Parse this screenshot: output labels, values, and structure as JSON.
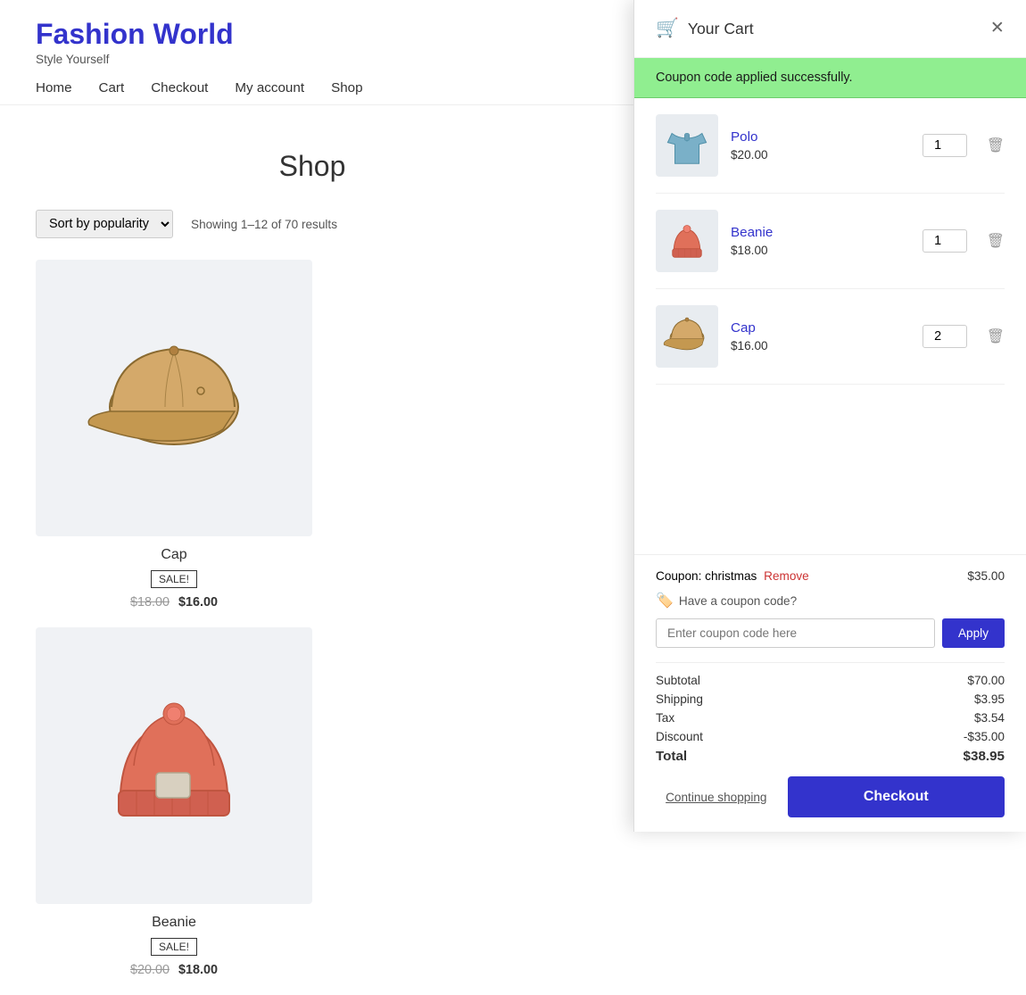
{
  "site": {
    "title": "Fashion World",
    "tagline": "Style Yourself",
    "nav": [
      {
        "label": "Home",
        "href": "#"
      },
      {
        "label": "Cart",
        "href": "#"
      },
      {
        "label": "Checkout",
        "href": "#"
      },
      {
        "label": "My account",
        "href": "#"
      },
      {
        "label": "Shop",
        "href": "#"
      }
    ]
  },
  "shop": {
    "page_title": "Shop",
    "sort_label": "Sort by popularity",
    "results_count": "Showing 1–12 of 70 results",
    "products": [
      {
        "name": "Cap",
        "badge": "SALE!",
        "original_price": "$18.00",
        "sale_price": "$16.00",
        "type": "cap"
      },
      {
        "name": "Beanie",
        "badge": "SALE!",
        "original_price": "$20.00",
        "sale_price": "$18.00",
        "type": "beanie"
      }
    ]
  },
  "cart": {
    "title": "Your Cart",
    "coupon_success": "Coupon code applied successfully.",
    "items": [
      {
        "name": "Polo",
        "price": "$20.00",
        "qty": 1,
        "type": "polo"
      },
      {
        "name": "Beanie",
        "price": "$18.00",
        "qty": 1,
        "type": "beanie"
      },
      {
        "name": "Cap",
        "price": "$16.00",
        "qty": 2,
        "type": "cap"
      }
    ],
    "coupon_label": "Coupon: christmas",
    "coupon_remove": "Remove",
    "coupon_total": "$35.00",
    "have_coupon": "Have a coupon code?",
    "coupon_placeholder": "Enter coupon code here",
    "apply_label": "Apply",
    "subtotal_label": "Subtotal",
    "subtotal_value": "$70.00",
    "shipping_label": "Shipping",
    "shipping_value": "$3.95",
    "tax_label": "Tax",
    "tax_value": "$3.54",
    "discount_label": "Discount",
    "discount_value": "-$35.00",
    "total_label": "Total",
    "total_value": "$38.95",
    "continue_shopping": "Continue shopping",
    "checkout_label": "Checkout"
  }
}
